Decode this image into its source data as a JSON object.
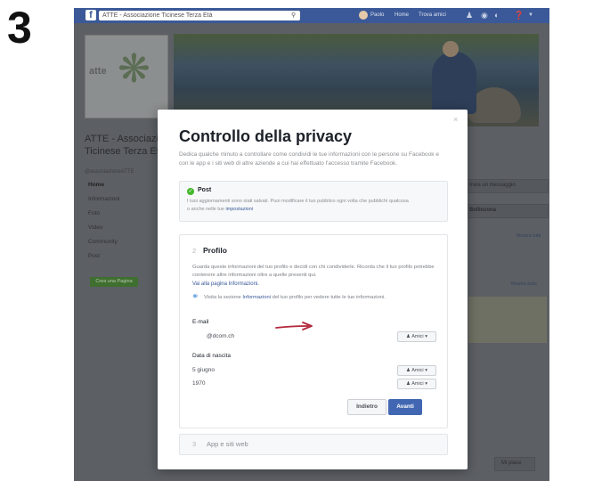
{
  "step_number": "3",
  "topbar": {
    "logo": "f",
    "search_text": "ATTE - Associazione Ticinese Terza Età",
    "links": [
      "Paolo",
      "Home",
      "Trova amici"
    ],
    "icons": [
      "friends-icon",
      "messenger-icon",
      "notifications-icon",
      "help-icon",
      "menu-arrow-icon"
    ]
  },
  "sidebar": {
    "logo_text": "atte",
    "org_name": "ATTE - Associazione Ticinese Terza Età",
    "handle": "@associazioneATTE",
    "items": [
      "Home",
      "Informazioni",
      "Foto",
      "Video",
      "Community",
      "Post"
    ],
    "create_page": "Crea una Pagina"
  },
  "right_column": {
    "message": "Invia un messaggio",
    "location": "Bellinzona",
    "see_all_1": "Mostra tutti",
    "see_all_2": "Mostra tutte",
    "like": "Mi piace"
  },
  "modal": {
    "close": "×",
    "title": "Controllo della privacy",
    "description": "Dedica qualche minuto a controllare come condividi le tue informazioni con le persone su Facebook e con le app e i siti web di altre aziende a cui hai effettuato l'accesso tramite Facebook.",
    "post": {
      "title": "Post",
      "description_start": "I tuoi aggiornamenti sono stati salvati. Puoi modificare il tuo pubblico ogni volta che pubblichi qualcosa o anche nelle tue ",
      "description_link": "impostazioni"
    },
    "profile": {
      "number": "2",
      "title": "Profilo",
      "description": "Guarda queste informazioni del tuo profilo e decidi con chi condividerle. Ricorda che il tuo profilo potrebbe contenere altre informazioni oltre a quelle presenti qui.",
      "link": "Vai alla pagina Informazioni.",
      "hint_start": "Visita la sezione ",
      "hint_link": "Informazioni",
      "hint_end": " del tuo profilo per vedere tutte le tue informazioni.",
      "email_label": "E-mail",
      "email_value": "@dcom.ch",
      "birth_label": "Data di nascita",
      "birth_day": "5 giugno",
      "birth_year": "1970",
      "audience_label": "Amici",
      "back_button": "Indietro",
      "next_button": "Avanti"
    },
    "apps": {
      "number": "3",
      "title": "App e siti web"
    }
  },
  "colors": {
    "facebook_blue": "#3b5998",
    "button_blue": "#4267b2",
    "check_green": "#42b72a",
    "arrow_red": "#b3263a"
  }
}
